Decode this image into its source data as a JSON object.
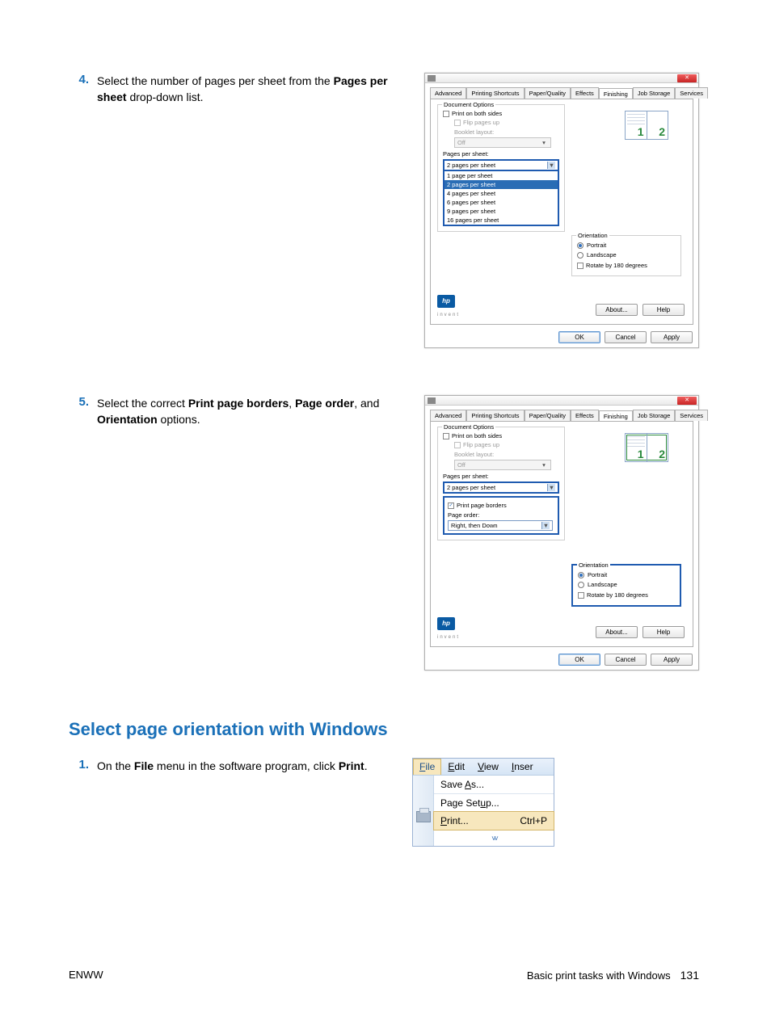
{
  "steps": {
    "s4": {
      "num": "4.",
      "text_a": "Select the number of pages per sheet from the ",
      "bold_a": "Pages per sheet",
      "text_b": " drop-down list."
    },
    "s5": {
      "num": "5.",
      "text_a": "Select the correct ",
      "bold_a": "Print page borders",
      "text_b": ", ",
      "bold_b": "Page order",
      "text_c": ", and ",
      "bold_c": "Orientation",
      "text_d": " options."
    },
    "s1b": {
      "num": "1.",
      "text_a": "On the ",
      "bold_a": "File",
      "text_b": " menu in the software program, click ",
      "bold_b": "Print",
      "text_c": "."
    }
  },
  "heading2": "Select page orientation with Windows",
  "dialog": {
    "tabs": [
      "Advanced",
      "Printing Shortcuts",
      "Paper/Quality",
      "Effects",
      "Finishing",
      "Job Storage",
      "Services"
    ],
    "doc_options_label": "Document Options",
    "print_both": "Print on both sides",
    "flip_up": "Flip pages up",
    "booklet_layout": "Booklet layout:",
    "booklet_off": "Off",
    "pps_label": "Pages per sheet:",
    "pps_selected": "2 pages per sheet",
    "pps_options": [
      "1 page per sheet",
      "2 pages per sheet",
      "4 pages per sheet",
      "6 pages per sheet",
      "9 pages per sheet",
      "16 pages per sheet"
    ],
    "print_borders": "Print page borders",
    "page_order_label": "Page order:",
    "page_order_val": "Right, then Down",
    "orientation_label": "Orientation",
    "portrait": "Portrait",
    "landscape": "Landscape",
    "rotate180": "Rotate by 180 degrees",
    "about": "About...",
    "help": "Help",
    "ok": "OK",
    "cancel": "Cancel",
    "apply": "Apply",
    "hp": "hp",
    "invent": "invent",
    "preview": {
      "n1": "1",
      "n2": "2"
    }
  },
  "filemenu": {
    "menubar": [
      "File",
      "Edit",
      "View",
      "Inser"
    ],
    "save_as": "Save As...",
    "page_setup": "Page Setup...",
    "print": "Print...",
    "shortcut": "Ctrl+P"
  },
  "footer": {
    "left": "ENWW",
    "right_text": "Basic print tasks with Windows",
    "page": "131"
  }
}
